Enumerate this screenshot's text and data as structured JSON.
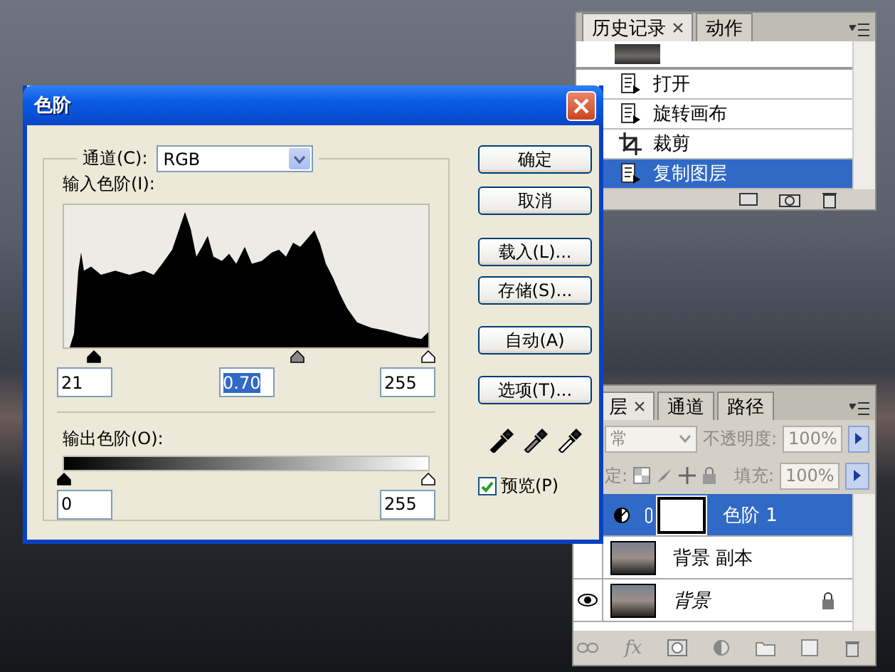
{
  "levels_dialog": {
    "title": "色阶",
    "channel_label": "通道(C):",
    "channel_value": "RGB",
    "input_label": "输入色阶(I):",
    "input_handles": [
      {
        "level": 0.082
      },
      {
        "level": 0.64
      },
      {
        "level": 1
      }
    ],
    "input_values": [
      {
        "value": "21",
        "highlighted": false
      },
      {
        "value": "0.70",
        "highlighted": true
      },
      {
        "value": "255",
        "highlighted": false
      }
    ],
    "output_label": "输出色阶(O):",
    "output_handles": [
      {
        "level": 0
      },
      {
        "level": 1
      }
    ],
    "output_values": [
      {
        "value": "0",
        "highlighted": false
      },
      {
        "value": "255",
        "highlighted": false
      }
    ],
    "buttons": [
      "确定",
      "取消",
      "载入(L)...",
      "存储(S)...",
      "自动(A)",
      "选项(T)..."
    ],
    "preview": {
      "label": "预览(P)",
      "checked": true
    }
  },
  "history_panel": {
    "tabs": [
      {
        "label": "历史记录",
        "selected": true
      },
      {
        "label": "动作",
        "selected": false
      }
    ],
    "steps": [
      {
        "label": "打开",
        "kind": "document",
        "selected": false
      },
      {
        "label": "旋转画布",
        "kind": "document",
        "selected": false
      },
      {
        "label": "裁剪",
        "kind": "crop",
        "selected": false
      },
      {
        "label": "复制图层",
        "kind": "document",
        "selected": true
      }
    ]
  },
  "layers_panel": {
    "tabs": [
      {
        "label": "层",
        "selected": true
      },
      {
        "label": "通道",
        "selected": false
      },
      {
        "label": "路径",
        "selected": false
      }
    ],
    "style_button": "fx",
    "blend_mode": "常",
    "opacity_label": "不透明度:",
    "opacity": "100%",
    "lock_label": "定:",
    "fill_label": "填充:",
    "fill": "100%",
    "layers": [
      {
        "name": "色阶 1",
        "kind": "adjustment",
        "selected": true,
        "visible": false,
        "locked": false
      },
      {
        "name": "背景 副本",
        "kind": "image",
        "selected": false,
        "visible": false,
        "locked": false
      },
      {
        "name": "背景",
        "kind": "background",
        "selected": false,
        "visible": true,
        "locked": true
      }
    ]
  }
}
